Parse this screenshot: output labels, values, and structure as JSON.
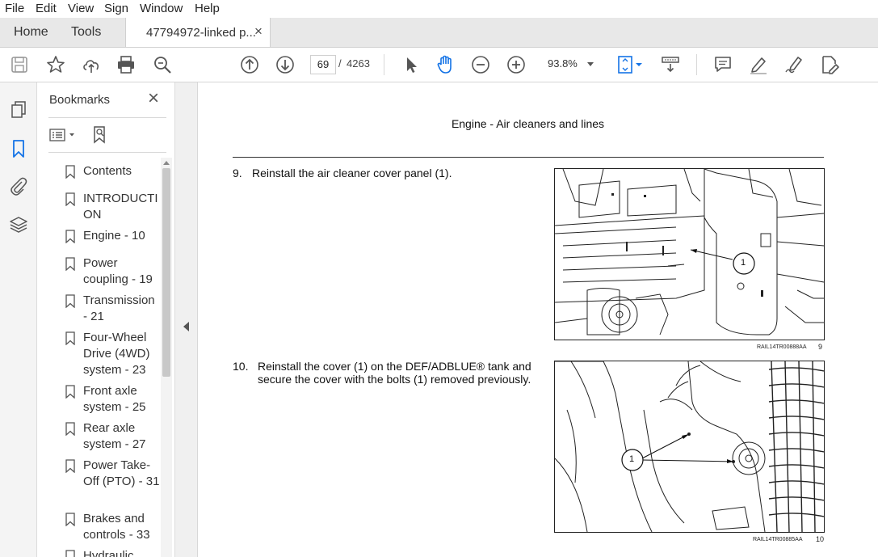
{
  "menu": [
    "File",
    "Edit",
    "View",
    "Sign",
    "Window",
    "Help"
  ],
  "tabs": {
    "home": "Home",
    "tools": "Tools",
    "document": "47794972-linked p...",
    "close": "×"
  },
  "toolbar": {
    "page_current": "69",
    "page_sep": "/",
    "page_total": "4263",
    "zoom": "93.8%"
  },
  "bookmarks": {
    "title": "Bookmarks",
    "close": "×",
    "items": [
      "Contents",
      "INTRODUCTI ON",
      "Engine - 10",
      "Power coupling - 19",
      "Transmission - 21",
      "Four-Wheel Drive (4WD) system - 23",
      "Front axle system - 25",
      "Rear axle system - 27",
      "Power Take-Off (PTO) - 31",
      "Brakes and controls - 33",
      "Hydraulic"
    ]
  },
  "document": {
    "header": "Engine - Air cleaners and lines",
    "steps": [
      {
        "num": "9.",
        "text": "Reinstall the air cleaner cover panel (1)."
      },
      {
        "num": "10.",
        "text_line1": "Reinstall the cover (1) on the DEF/ADBLUE® tank and",
        "text_line2": "secure the cover with the bolts (1) removed previously."
      }
    ],
    "figures": [
      {
        "callout": "1",
        "code": "RAIL14TR00888AA",
        "num": "9"
      },
      {
        "callout": "1",
        "code": "RAIL14TR00885AA",
        "num": "10"
      }
    ]
  },
  "colors": {
    "accent": "#1473e6",
    "panel_bg": "#f4f4f4",
    "tab_bg": "#e8e8e8"
  }
}
